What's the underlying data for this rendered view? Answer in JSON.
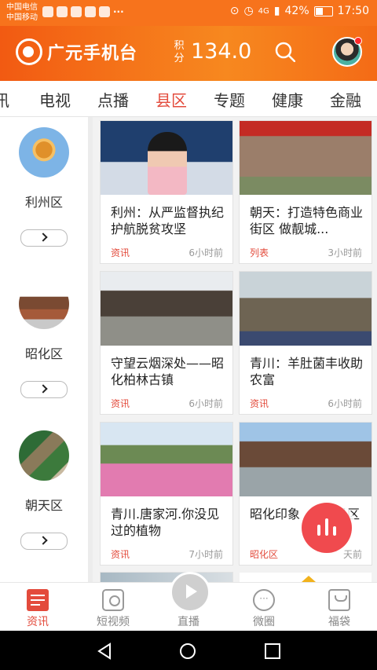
{
  "status_bar": {
    "carrier1": "中国电信",
    "carrier2": "中国移动",
    "more": "···",
    "network": "4G",
    "battery": "42%",
    "time": "17:50"
  },
  "header": {
    "logo_text": "广元手机台",
    "points_label": "积分",
    "points_value": "134.0"
  },
  "tabs": [
    "讯",
    "电视",
    "点播",
    "县区",
    "专题",
    "健康",
    "金融"
  ],
  "active_tab": "县区",
  "districts": [
    {
      "name": "利州区"
    },
    {
      "name": "昭化区"
    },
    {
      "name": "朝天区"
    }
  ],
  "cards": [
    {
      "title": "利州：从严监督执纪 护航脱贫攻坚",
      "source": "资讯",
      "time": "6小时前"
    },
    {
      "title": "朝天：打造特色商业街区 做靓城...",
      "source": "列表",
      "time": "3小时前"
    },
    {
      "title": "守望云烟深处——昭化柏林古镇",
      "source": "资讯",
      "time": "6小时前"
    },
    {
      "title": "青川：羊肚菌丰收助农富",
      "source": "资讯",
      "time": "6小时前"
    },
    {
      "title": "青川.唐家河.你没见过的植物",
      "source": "资讯",
      "time": "7小时前"
    },
    {
      "title": "昭化印象",
      "title_tail": "景区",
      "source": "昭化区",
      "time": "天前"
    }
  ],
  "bottom_nav": [
    {
      "label": "资讯",
      "icon": "news-icon"
    },
    {
      "label": "短视频",
      "icon": "camera-icon"
    },
    {
      "label": "直播",
      "icon": "play-icon"
    },
    {
      "label": "微圈",
      "icon": "chat-icon"
    },
    {
      "label": "福袋",
      "icon": "bag-icon"
    }
  ],
  "colors": {
    "brand_orange": "#f7731c",
    "accent_red": "#e34b3c",
    "fab_red": "#f04a4e"
  }
}
